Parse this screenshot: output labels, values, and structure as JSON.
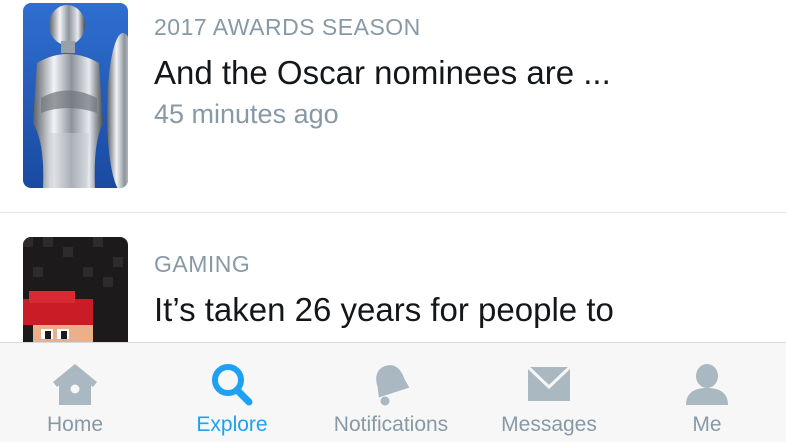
{
  "feed": {
    "stories": [
      {
        "category": "2017 AWARDS SEASON",
        "headline": "And the Oscar nominees are ...",
        "timestamp": "45 minutes ago",
        "thumbnail_icon": "oscar-statue-photo"
      },
      {
        "category": "GAMING",
        "headline": "It’s taken 26 years for people to",
        "thumbnail_icon": "mario-pixel-art"
      }
    ]
  },
  "tabbar": {
    "active_tab": "Explore",
    "tabs": [
      {
        "label": "Home",
        "icon": "home-icon"
      },
      {
        "label": "Explore",
        "icon": "search-icon"
      },
      {
        "label": "Notifications",
        "icon": "bell-icon"
      },
      {
        "label": "Messages",
        "icon": "envelope-icon"
      },
      {
        "label": "Me",
        "icon": "person-icon"
      }
    ]
  },
  "colors": {
    "accent": "#1da1f2",
    "secondary_text": "#8899a6",
    "primary_text": "#14171a",
    "tab_icon": "#aab8c2"
  }
}
